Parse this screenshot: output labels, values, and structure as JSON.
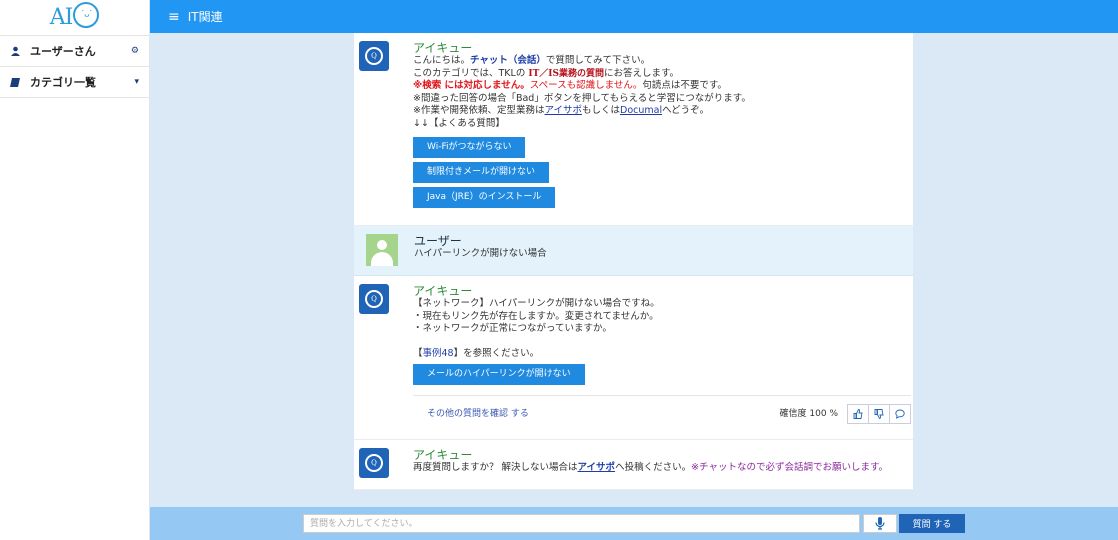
{
  "app": {
    "logo": "AI"
  },
  "sidebar": {
    "items": [
      {
        "label": "ユーザーさん",
        "icon": "user-icon",
        "right_icon": "gear-icon"
      },
      {
        "label": "カテゴリ一覧",
        "icon": "book-icon",
        "right_icon": "caret-down-icon"
      }
    ]
  },
  "header": {
    "title": "IT関連"
  },
  "messages": {
    "m1": {
      "name": "アイキュー",
      "l1_a": "こんにちは。",
      "l1_b": "チャット（会話）",
      "l1_c": "で質問してみて下さい。",
      "l2_a": "このカテゴリでは、TKLの ",
      "l2_b": "IT／IS業務の質問",
      "l2_c": "にお答えします。",
      "l3_a": "※検索 には対応しません。",
      "l3_b": "スペースも認識しません。",
      "l3_c": "句読点は不要です。",
      "l4": "※間違った回答の場合「Bad」ボタンを押してもらえると学習につながります。",
      "l5_a": "※作業や開発依頼、定型業務は",
      "l5_b": "アイサポ",
      "l5_c": "もしくは",
      "l5_d": "Documal",
      "l5_e": "へどうぞ。",
      "l6": "↓↓【よくある質問】",
      "buttons": [
        "Wi-Fiがつながらない",
        "制限付きメールが開けない",
        "Java（JRE）のインストール"
      ]
    },
    "m2": {
      "name": "ユーザー",
      "text": "ハイパーリンクが開けない場合"
    },
    "m3": {
      "name": "アイキュー",
      "l1": "【ネットワーク】ハイパーリンクが開けない場合ですね。",
      "l2": "・現在もリンク先が存在しますか。変更されてませんか。",
      "l3": "・ネットワークが正常につながっていますか。",
      "ref_a": "【",
      "ref_b": "事例48",
      "ref_c": "】を参照ください。",
      "button": "メールのハイパーリンクが開けない",
      "other_link": "その他の質問を確認 する",
      "confidence": "確信度 100 %"
    },
    "m4": {
      "name": "アイキュー",
      "t_a": "再度質問しますか？ 解決しない場合は",
      "t_b": "アイサポ",
      "t_c": "へ投稿ください。",
      "t_d": "※チャットなので必ず会話調でお願いします。"
    }
  },
  "input": {
    "placeholder": "質問を入力してください。",
    "submit": "質問 する"
  },
  "colors": {
    "header": "#2196f3",
    "bot_avatar": "#1f64b6",
    "user_bg": "#e3f2fb"
  }
}
